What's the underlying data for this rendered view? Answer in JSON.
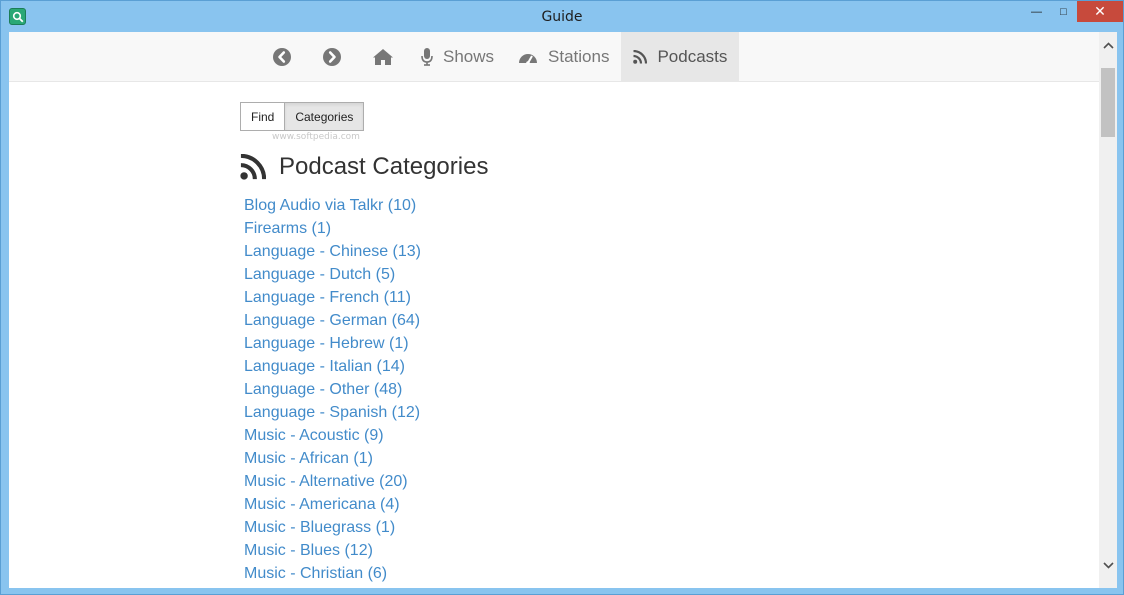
{
  "window": {
    "title": "Guide",
    "controls": {
      "minimize": "—",
      "maximize": "□",
      "close": "✕"
    }
  },
  "navbar": {
    "back_icon": "chevron-circle-left-icon",
    "forward_icon": "chevron-circle-right-icon",
    "home_icon": "home-icon",
    "items": [
      {
        "label": "Shows",
        "icon": "microphone-icon"
      },
      {
        "label": "Stations",
        "icon": "dashboard-icon"
      },
      {
        "label": "Podcasts",
        "icon": "rss-icon",
        "active": true
      }
    ]
  },
  "toggle": {
    "find_label": "Find",
    "categories_label": "Categories",
    "active": "Categories"
  },
  "watermark": "www.softpedia.com",
  "heading": {
    "title": "Podcast Categories",
    "icon": "rss-icon"
  },
  "categories": [
    "Blog Audio via Talkr (10)",
    "Firearms (1)",
    "Language - Chinese (13)",
    "Language - Dutch (5)",
    "Language - French (11)",
    "Language - German (64)",
    "Language - Hebrew (1)",
    "Language - Italian (14)",
    "Language - Other (48)",
    "Language - Spanish (12)",
    "Music - Acoustic (9)",
    "Music - African (1)",
    "Music - Alternative (20)",
    "Music - Americana (4)",
    "Music - Bluegrass (1)",
    "Music - Blues (12)",
    "Music - Christian (6)"
  ],
  "colors": {
    "link": "#428bca",
    "navbar_bg": "#f8f8f8",
    "active_tab_bg": "#e7e7e7",
    "window_frame": "#89c4ef",
    "close_button": "#c74a3c"
  }
}
